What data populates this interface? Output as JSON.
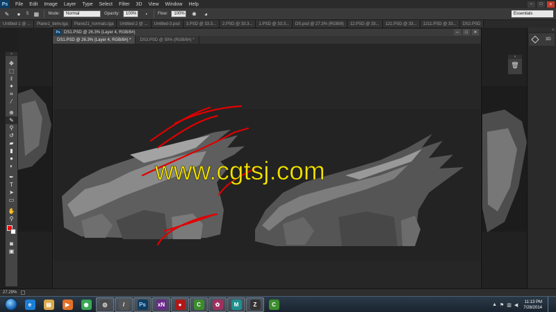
{
  "app": {
    "logo": "Ps"
  },
  "menubar": {
    "items": [
      "File",
      "Edit",
      "Image",
      "Layer",
      "Type",
      "Select",
      "Filter",
      "3D",
      "View",
      "Window",
      "Help"
    ]
  },
  "window_controls": {
    "minimize": "–",
    "maximize": "□",
    "close": "✕"
  },
  "options": {
    "mode_label": "Mode:",
    "mode_value": "Normal",
    "opacity_label": "Opacity:",
    "opacity_value": "100%",
    "flow_label": "Flow:",
    "flow_value": "100%",
    "brush_size": "5",
    "workspace": "Essentials"
  },
  "tabs": [
    "Untitled-1 @ ...",
    "Plane1_deriv.tga",
    "Plane21_normals.tga",
    "Untitled-2 @ ...",
    "Untitled-3.psd",
    "3.PSD @ 33.3...",
    "2.PSD @ 33.3...",
    "1.PSD @ 33.3...",
    "DS.psd @ 27.3% (RGB/8)",
    "12.PSD @ 33...",
    "121.PSD @ 33...",
    "1211.PSD @ 33...",
    "DS2.PSD"
  ],
  "docwindow": {
    "title": "DS1.PSD @ 26.3% (Layer 4, RGB/8#)",
    "tabs": [
      {
        "label": "DS1.PSD @ 26.3% (Layer 4, RGB/8#) *",
        "active": true
      },
      {
        "label": "DS3.PSD @ 50% (RGB/8#) *",
        "active": false
      }
    ]
  },
  "canvas": {
    "watermark": "www.cgtsj.com",
    "watermark_color": "#f5e400",
    "stroke_color": "#e00000"
  },
  "tools": {
    "foreground_color": "#ff0000",
    "background_color": "#ffffff"
  },
  "dock": {
    "panel_3d_label": "3D"
  },
  "status": {
    "zoom": "27.29%"
  },
  "taskbar": {
    "apps": [
      {
        "name": "internet-explorer",
        "glyph": "e",
        "color": "#1c7fd6"
      },
      {
        "name": "file-explorer",
        "glyph": "▤",
        "color": "#d9a84a"
      },
      {
        "name": "media-player",
        "glyph": "▶",
        "color": "#e2722a"
      },
      {
        "name": "chrome",
        "glyph": "◉",
        "color": "#3aa757"
      },
      {
        "name": "app-dark",
        "glyph": "◎",
        "color": "#4a4a4a"
      },
      {
        "name": "tablet-pen",
        "glyph": "/",
        "color": "#555"
      },
      {
        "name": "photoshop",
        "glyph": "Ps",
        "color": "#0f3c60"
      },
      {
        "name": "xnview",
        "glyph": "xN",
        "color": "#6a2a8a"
      },
      {
        "name": "red-drop",
        "glyph": "●",
        "color": "#b01818"
      },
      {
        "name": "cinema-c",
        "glyph": "C",
        "color": "#3c8c2c"
      },
      {
        "name": "render-app",
        "glyph": "✿",
        "color": "#a03060"
      },
      {
        "name": "maya",
        "glyph": "M",
        "color": "#1e8f8f"
      },
      {
        "name": "zbrush",
        "glyph": "Z",
        "color": "#333"
      },
      {
        "name": "cinema-c2",
        "glyph": "C",
        "color": "#3c8c2c"
      }
    ],
    "time": "11:13 PM",
    "date": "7/28/2014"
  }
}
